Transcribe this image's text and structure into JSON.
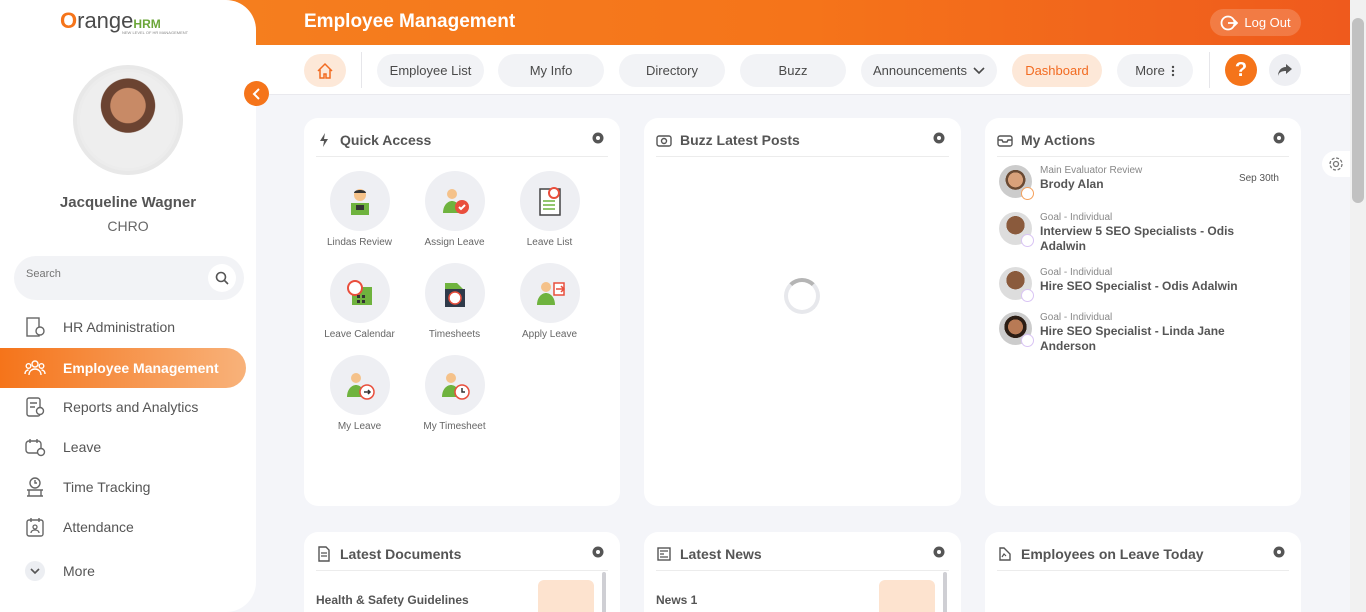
{
  "header": {
    "title": "Employee Management",
    "logout_label": "Log Out"
  },
  "nav": {
    "home_label": "",
    "items": [
      "Employee List",
      "My Info",
      "Directory",
      "Buzz",
      "Announcements",
      "Dashboard",
      "More"
    ]
  },
  "logo": {
    "orange": "O",
    "rest": "range",
    "hrm": "HRM",
    "tagline": "NEW LEVEL OF HR MANAGEMENT"
  },
  "user": {
    "name": "Jacqueline Wagner",
    "role": "CHRO"
  },
  "search": {
    "placeholder": "Search"
  },
  "sidebar": {
    "items": [
      {
        "label": "HR Administration",
        "icon": "building-icon"
      },
      {
        "label": "Employee Management",
        "icon": "people-icon",
        "active": true
      },
      {
        "label": "Reports and Analytics",
        "icon": "report-icon"
      },
      {
        "label": "Leave",
        "icon": "leave-icon"
      },
      {
        "label": "Time Tracking",
        "icon": "clock-icon"
      },
      {
        "label": "Attendance",
        "icon": "attendance-icon"
      },
      {
        "label": "More",
        "icon": "chevron-down-icon"
      }
    ]
  },
  "quick_access": {
    "title": "Quick Access",
    "items": [
      "Lindas Review",
      "Assign Leave",
      "Leave List",
      "Leave Calendar",
      "Timesheets",
      "Apply Leave",
      "My Leave",
      "My Timesheet"
    ]
  },
  "buzz": {
    "title": "Buzz Latest Posts"
  },
  "my_actions": {
    "title": "My Actions",
    "items": [
      {
        "category": "Main Evaluator Review",
        "title": "Brody Alan",
        "date": "Sep 30th"
      },
      {
        "category": "Goal - Individual",
        "title": "Interview 5 SEO Specialists - Odis Adalwin",
        "date": ""
      },
      {
        "category": "Goal - Individual",
        "title": "Hire SEO Specialist - Odis Adalwin",
        "date": ""
      },
      {
        "category": "Goal - Individual",
        "title": "Hire SEO Specialist - Linda Jane Anderson",
        "date": ""
      }
    ]
  },
  "latest_documents": {
    "title": "Latest Documents",
    "first_item": "Health & Safety Guidelines"
  },
  "latest_news": {
    "title": "Latest News",
    "first_item": "News 1"
  },
  "leave_today": {
    "title": "Employees on Leave Today"
  },
  "colors": {
    "accent": "#f5741a",
    "accent_light": "#fde8d8"
  }
}
